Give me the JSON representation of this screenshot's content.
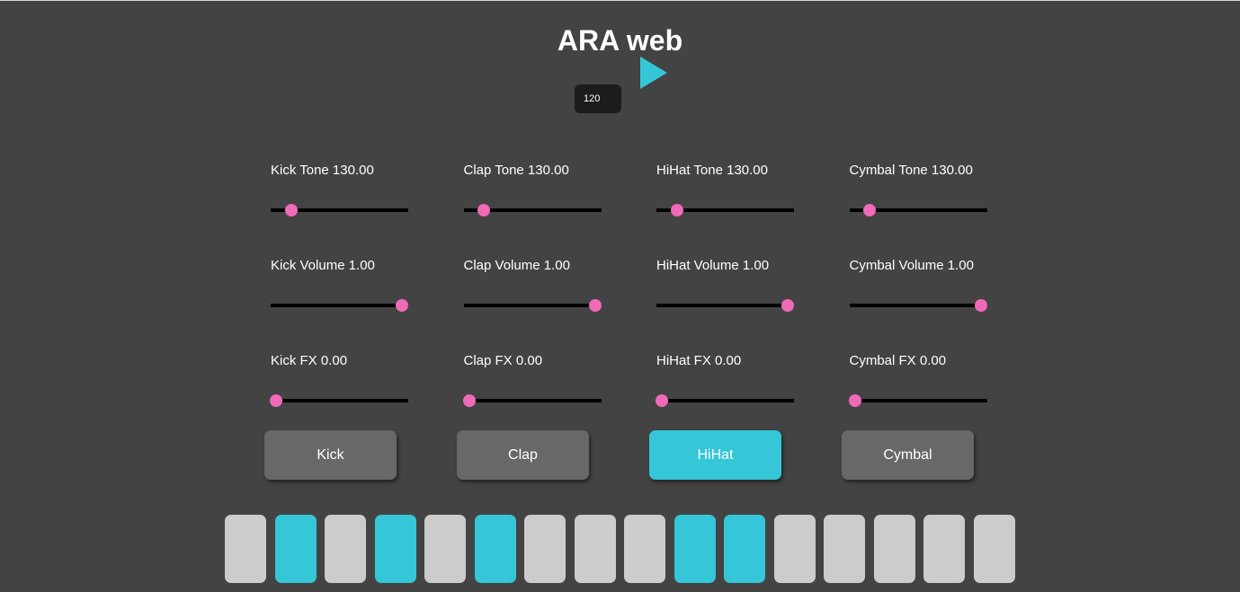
{
  "app": {
    "title": "ARA web"
  },
  "transport": {
    "play_icon": "play-icon",
    "bpm_value": "120"
  },
  "colors": {
    "background": "#434343",
    "accent": "#35c6d8",
    "thumb": "#f06ab8",
    "step_off": "#cccccc",
    "button_inactive": "#686868"
  },
  "controls": [
    {
      "id": "kick-tone",
      "label": "Kick Tone 130.00",
      "level": 0.12
    },
    {
      "id": "clap-tone",
      "label": "Clap Tone 130.00",
      "level": 0.12
    },
    {
      "id": "hihat-tone",
      "label": "HiHat Tone 130.00",
      "level": 0.12
    },
    {
      "id": "cymbal-tone",
      "label": "Cymbal Tone 130.00",
      "level": 0.12
    },
    {
      "id": "kick-volume",
      "label": "Kick Volume 1.00",
      "level": 1.0
    },
    {
      "id": "clap-volume",
      "label": "Clap Volume 1.00",
      "level": 1.0
    },
    {
      "id": "hihat-volume",
      "label": "HiHat Volume 1.00",
      "level": 1.0
    },
    {
      "id": "cymbal-volume",
      "label": "Cymbal Volume 1.00",
      "level": 1.0
    },
    {
      "id": "kick-fx",
      "label": "Kick FX 0.00",
      "level": 0.0
    },
    {
      "id": "clap-fx",
      "label": "Clap FX 0.00",
      "level": 0.0
    },
    {
      "id": "hihat-fx",
      "label": "HiHat FX 0.00",
      "level": 0.0
    },
    {
      "id": "cymbal-fx",
      "label": "Cymbal FX 0.00",
      "level": 0.0
    }
  ],
  "instruments": [
    {
      "id": "kick",
      "label": "Kick",
      "active": false
    },
    {
      "id": "clap",
      "label": "Clap",
      "active": false
    },
    {
      "id": "hihat",
      "label": "HiHat",
      "active": true
    },
    {
      "id": "cymbal",
      "label": "Cymbal",
      "active": false
    }
  ],
  "steps": [
    false,
    true,
    false,
    true,
    false,
    true,
    false,
    false,
    false,
    true,
    true,
    false,
    false,
    false,
    false,
    false
  ]
}
